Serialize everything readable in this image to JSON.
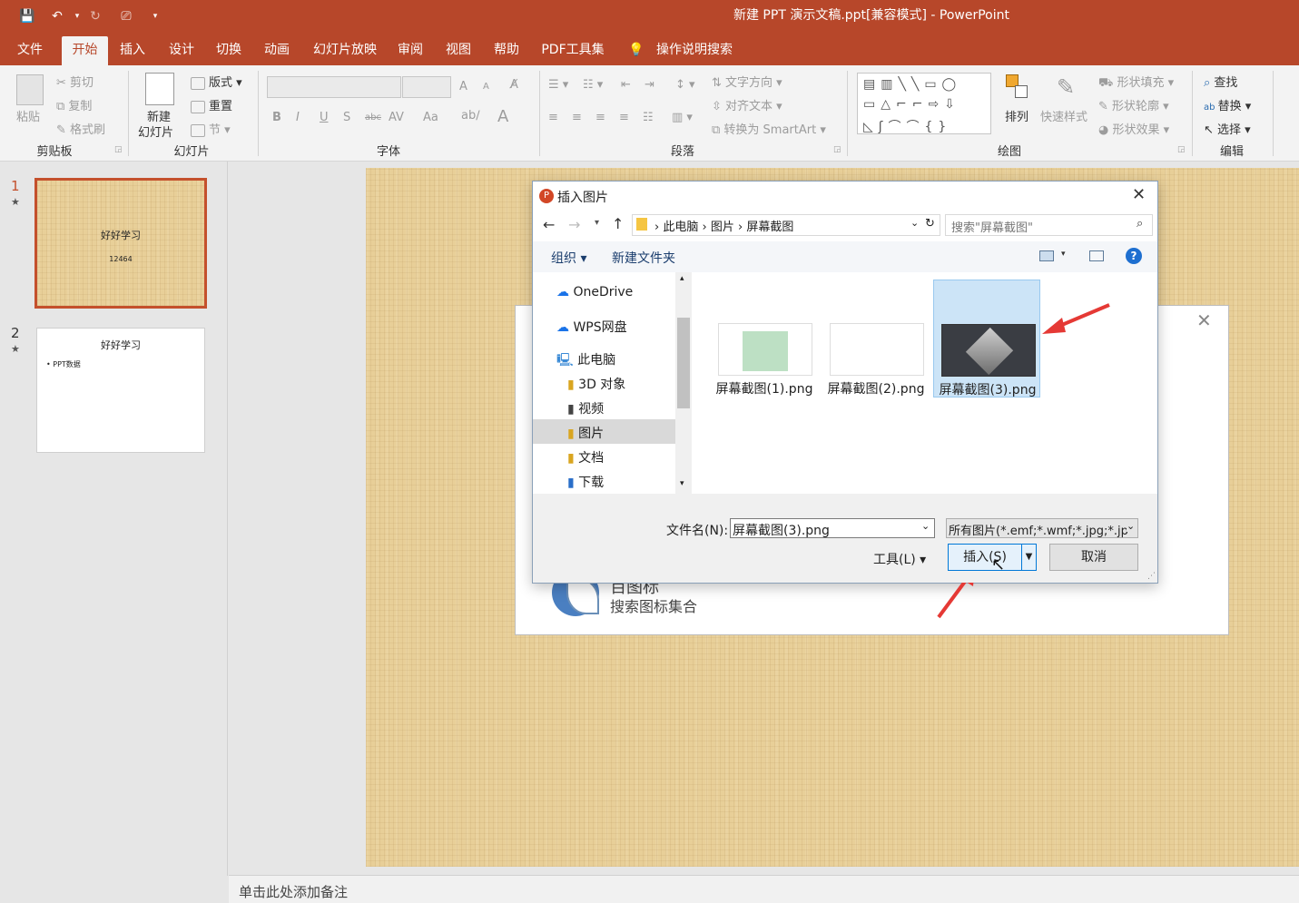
{
  "window": {
    "title": "新建 PPT 演示文稿.ppt[兼容模式]  -  PowerPoint"
  },
  "tabs": [
    "文件",
    "开始",
    "插入",
    "设计",
    "切换",
    "动画",
    "幻灯片放映",
    "审阅",
    "视图",
    "帮助",
    "PDF工具集"
  ],
  "tell_me": "操作说明搜索",
  "ribbon": {
    "clipboard": {
      "label": "剪贴板",
      "paste": "粘贴",
      "cut": "剪切",
      "copy": "复制",
      "format_painter": "格式刷"
    },
    "slides": {
      "label": "幻灯片",
      "new_slide_1": "新建",
      "new_slide_2": "幻灯片",
      "layout": "版式",
      "reset": "重置",
      "section": "节"
    },
    "font": {
      "label": "字体",
      "bold": "B",
      "italic": "I",
      "underline": "U",
      "shadow": "S",
      "strike": "abc",
      "spacing": "AV",
      "case": "Aa",
      "grow": "A",
      "shrink": "A",
      "color": "A"
    },
    "paragraph": {
      "label": "段落",
      "text_direction": "文字方向",
      "align_text": "对齐文本",
      "smartart": "转换为 SmartArt"
    },
    "drawing": {
      "label": "绘图",
      "arrange": "排列",
      "quick_styles": "快速样式",
      "shape_fill": "形状填充",
      "shape_outline": "形状轮廓",
      "shape_effects": "形状效果"
    },
    "editing": {
      "label": "编辑",
      "find": "查找",
      "replace": "替换",
      "select": "选择"
    }
  },
  "slides": [
    {
      "num": "1",
      "title": "好好学习",
      "subtitle": "12464"
    },
    {
      "num": "2",
      "title": "好好学习",
      "bullet": "• PPT数据"
    }
  ],
  "notes_placeholder": "单击此处添加备注",
  "background_dialog": {
    "text1": "百图标",
    "text2": "搜索图标集合"
  },
  "dialog": {
    "title": "插入图片",
    "breadcrumb": [
      "此电脑",
      "图片",
      "屏幕截图"
    ],
    "search_placeholder": "搜索\"屏幕截图\"",
    "organize": "组织",
    "new_folder": "新建文件夹",
    "nav": [
      "OneDrive",
      "WPS网盘",
      "此电脑",
      "3D 对象",
      "视频",
      "图片",
      "文档",
      "下载"
    ],
    "files": [
      "屏幕截图(1).png",
      "屏幕截图(2).png",
      "屏幕截图(3).png"
    ],
    "selected_file": "屏幕截图(3).png",
    "filename_label": "文件名(N):",
    "filename_value": "屏幕截图(3).png",
    "filetype": "所有图片(*.emf;*.wmf;*.jpg;*.jp",
    "tools": "工具(L)",
    "insert": "插入(S)",
    "cancel": "取消"
  },
  "colors": {
    "accent": "#b7472a",
    "selection": "#cce4f7",
    "arrow": "#e53935"
  }
}
